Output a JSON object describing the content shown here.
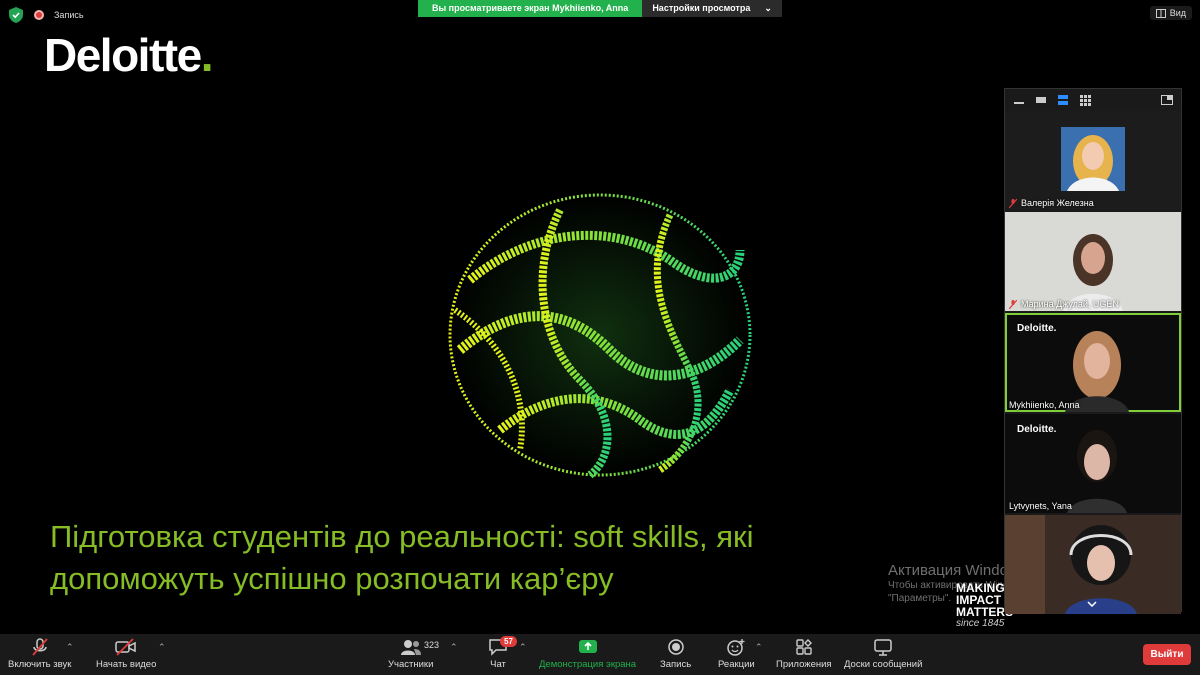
{
  "top": {
    "recording_label": "Запись",
    "view_banner": "Вы просматриваете экран Mykhiienko, Anna",
    "view_settings": "Настройки просмотра",
    "view_button": "Вид"
  },
  "slide": {
    "logo_text": "Deloitte",
    "logo_dot": ".",
    "title_line1": "Підготовка студентів до реальності: soft skills, які",
    "title_line2": "допоможуть успішно розпочати кар’єру",
    "impact_line1": "MAKING",
    "impact_line2": "IMPACT",
    "impact_line3": "MATTERS",
    "impact_since": "since 1845"
  },
  "watermark": {
    "line1": "Активация Windows",
    "line2": "Чтобы активировать Windows, перейдите в раздел",
    "line3": "\"Параметры\"."
  },
  "participants": [
    {
      "name": "Валерія Железна",
      "muted": true
    },
    {
      "name": "Марина Джулай, UGEN",
      "muted": true
    },
    {
      "name": "Mykhiienko, Anna",
      "muted": false,
      "logo": "Deloitte."
    },
    {
      "name": "Lytvynets, Yana",
      "muted": false,
      "logo": "Deloitte."
    },
    {
      "name": "",
      "muted": false
    }
  ],
  "toolbar": {
    "audio": "Включить звук",
    "video": "Начать видео",
    "participants": "Участники",
    "participants_count": "323",
    "chat": "Чат",
    "chat_badge": "57",
    "share": "Демонстрация экрана",
    "record": "Запись",
    "reactions": "Реакции",
    "apps": "Приложения",
    "whiteboards": "Доски сообщений",
    "leave": "Выйти"
  },
  "colors": {
    "accent_green": "#22b14c",
    "deloitte_green": "#86bc25",
    "leave_red": "#e03b3b"
  }
}
